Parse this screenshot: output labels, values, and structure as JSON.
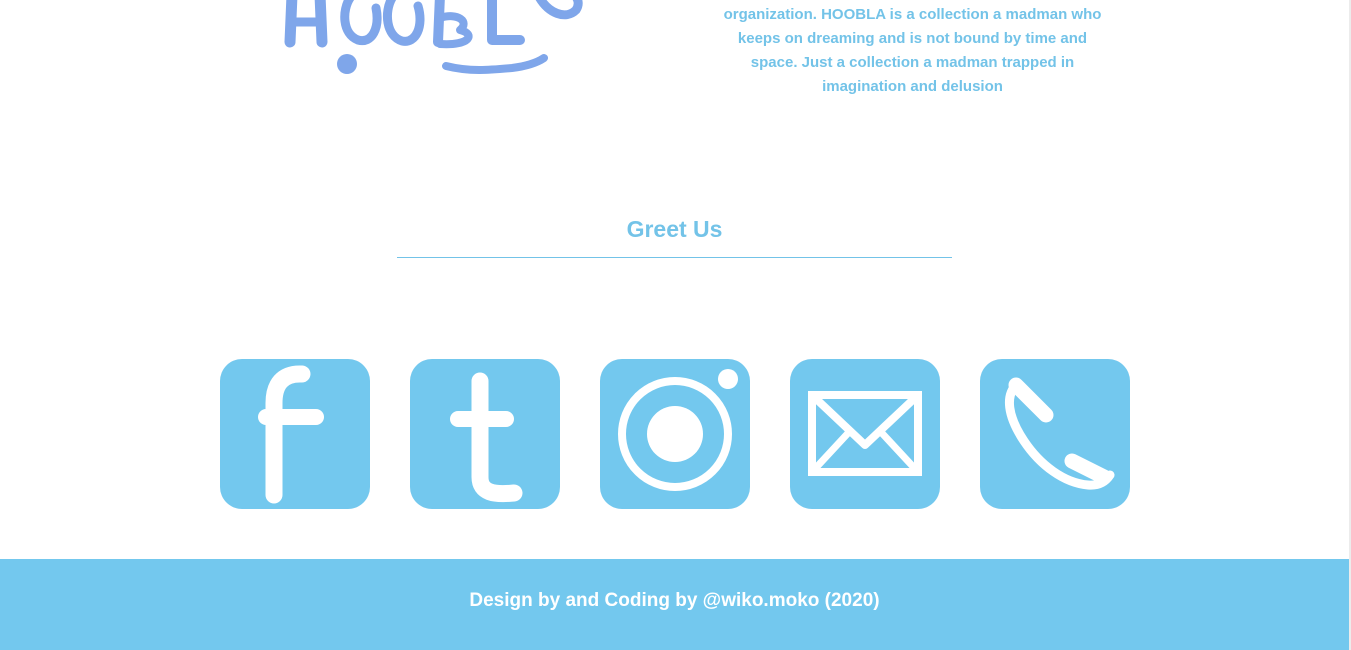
{
  "logo": {
    "icon": "hoobla-logo",
    "color": "#7fa6ea"
  },
  "about": {
    "text_lines": [
      "organization. HOOBLA is a collection a madman who",
      "keeps on dreaming and is not bound by time and",
      "space. Just a collection a madman trapped in",
      "imagination and delusion"
    ]
  },
  "greet": {
    "title": "Greet Us"
  },
  "social": [
    {
      "icon": "facebook-icon"
    },
    {
      "icon": "tumblr-icon"
    },
    {
      "icon": "instagram-icon"
    },
    {
      "icon": "email-icon"
    },
    {
      "icon": "phone-icon"
    }
  ],
  "footer": {
    "credit": "Design by and Coding by @wiko.moko (2020)"
  },
  "colors": {
    "accent": "#73c8ee",
    "text_accent": "#73c3e8",
    "logo": "#7fa6ea",
    "white": "#ffffff"
  }
}
